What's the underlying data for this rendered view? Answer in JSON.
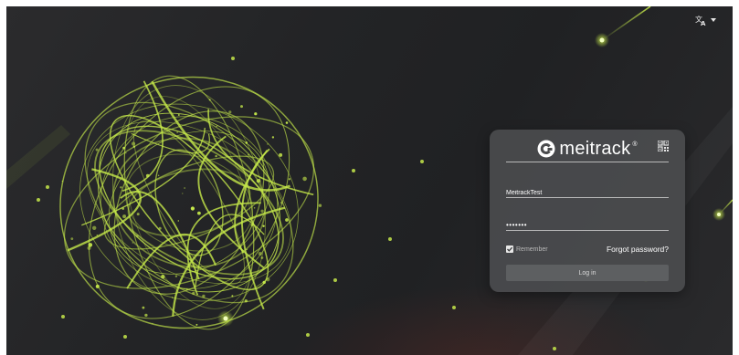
{
  "page": {
    "accent_color": "#c5e84a"
  },
  "language_switcher": {
    "icon": "translate-icon",
    "caret_icon": "caret-down-icon"
  },
  "login": {
    "brand": "meitrack",
    "registered_mark": "®",
    "logo_icon": "meitrack-logo-icon",
    "qr_icon": "qr-code-icon",
    "username_value": "MeitrackTest",
    "password_value": "•••••••",
    "remember_label": "Remember",
    "remember_checked": true,
    "forgot_label": "Forgot password?",
    "login_button_label": "Log in"
  }
}
